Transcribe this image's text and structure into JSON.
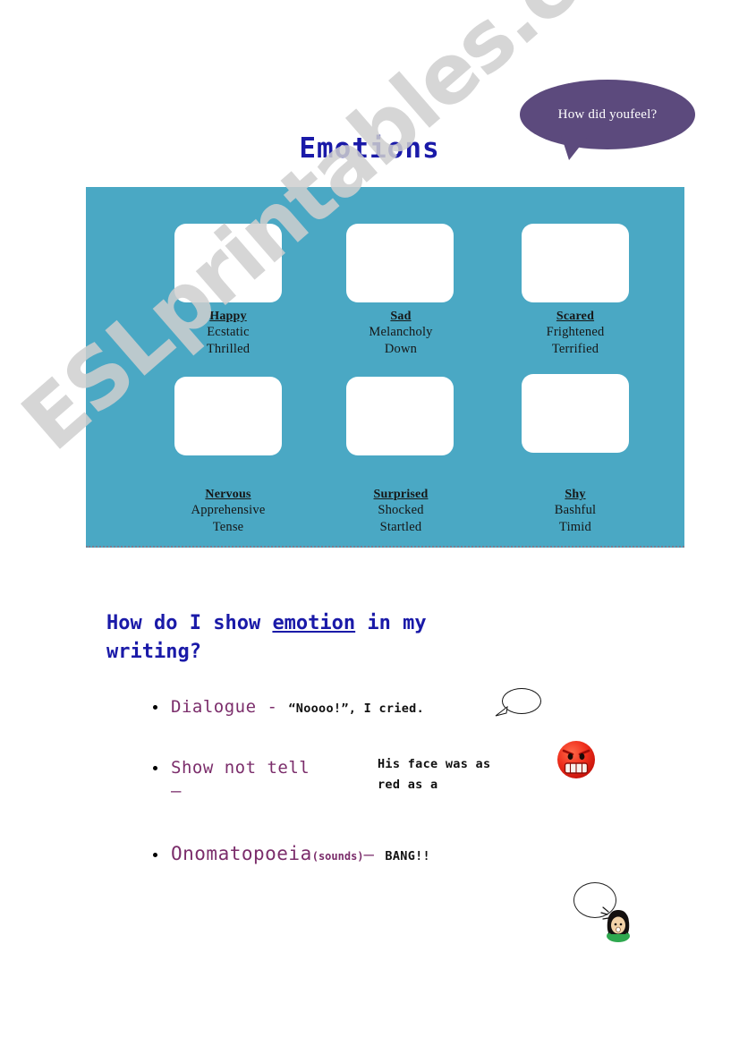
{
  "title": "Emotions",
  "speech_bubble_top": {
    "text": "How did youfeel?",
    "color": "#5c4a7d"
  },
  "watermark": {
    "text": "ESLprintables.com",
    "color": "#cfcfcf"
  },
  "panel": {
    "background_color": "#4aa8c4",
    "emotions": [
      {
        "name": "Happy",
        "synonyms": [
          "Ecstatic",
          "Thrilled"
        ]
      },
      {
        "name": "Sad",
        "synonyms": [
          "Melancholy",
          "Down"
        ]
      },
      {
        "name": "Scared",
        "synonyms": [
          "Frightened",
          "Terrified"
        ]
      },
      {
        "name": "Nervous",
        "synonyms": [
          "Apprehensive",
          "Tense"
        ]
      },
      {
        "name": "Surprised",
        "synonyms": [
          "Shocked",
          "Startled"
        ]
      },
      {
        "name": "Shy",
        "synonyms": [
          "Bashful",
          "Timid"
        ]
      }
    ]
  },
  "question": {
    "part1": "How do I show ",
    "underlined": "emotion",
    "part2": " in my writing?",
    "color": "#1a1aa8"
  },
  "techniques": {
    "accent_color": "#7b2d6b",
    "items": [
      {
        "label": "Dialogue - ",
        "example": "“Noooo!”, I cried."
      },
      {
        "label": "Show not tell",
        "dash": "–",
        "example_line1": "His face was as",
        "example_line2": "red as a"
      },
      {
        "label": "Onomatopoeia",
        "note": "(sounds)",
        "dash": "– ",
        "example": "BANG!!"
      }
    ]
  },
  "icons": {
    "speech_bubble": "speech-bubble-icon",
    "angry_face": "angry-red-face-icon",
    "thought_bubble": "thought-bubble-icon",
    "girl_face": "girl-face-icon"
  }
}
